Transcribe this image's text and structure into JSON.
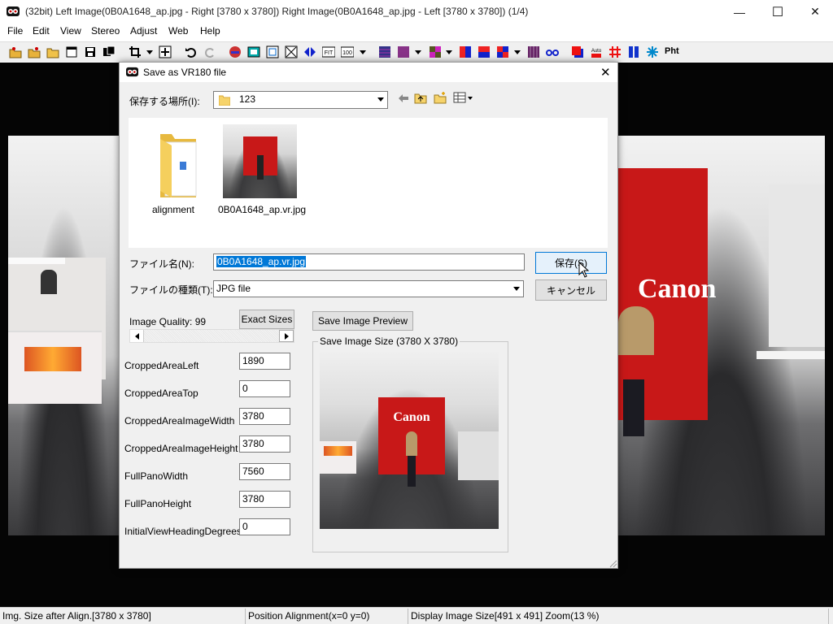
{
  "window": {
    "title": "(32bit) Left Image(0B0A1648_ap.jpg - Right [3780 x 3780]) Right Image(0B0A1648_ap.jpg - Left [3780 x 3780])  (1/4)",
    "minimize": "—",
    "maximize": "☐",
    "close": "✕"
  },
  "menu": {
    "file": "File",
    "edit": "Edit",
    "view": "View",
    "stereo": "Stereo",
    "adjust": "Adjust",
    "web": "Web",
    "help": "Help"
  },
  "toolbar": {
    "auto_label": "Auto",
    "pht_label": "Pht"
  },
  "dialog": {
    "title": "Save as VR180 file",
    "close": "✕",
    "location_label": "保存する場所(I):",
    "location_value": "123",
    "files": [
      {
        "name": "alignment",
        "kind": "folder"
      },
      {
        "name": "0B0A1648_ap.vr.jpg",
        "kind": "image"
      }
    ],
    "filename_label": "ファイル名(N):",
    "filename_value": "0B0A1648_ap.vr.jpg",
    "filetype_label": "ファイルの種類(T):",
    "filetype_value": "JPG file",
    "save_button": "保存(S)",
    "cancel_button": "キャンセル",
    "quality_label": "Image Quality: 99",
    "exact_sizes_button": "Exact Sizes",
    "preview_button": "Save Image Preview",
    "save_size_label": "Save Image Size (3780 X 3780)",
    "params": [
      {
        "label": "CroppedAreaLeft",
        "value": "1890"
      },
      {
        "label": "CroppedAreaTop",
        "value": "0"
      },
      {
        "label": "CroppedAreaImageWidth",
        "value": "3780"
      },
      {
        "label": "CroppedAreaImageHeight",
        "value": "3780"
      },
      {
        "label": "FullPanoWidth",
        "value": "7560"
      },
      {
        "label": "FullPanoHeight",
        "value": "3780"
      },
      {
        "label": "InitialViewHeadingDegrees",
        "value": "0"
      }
    ],
    "preview_sign": "Canon"
  },
  "status": {
    "size_after_align": "Img. Size after Align.[3780 x 3780]",
    "position": "Position Alignment(x=0 y=0)",
    "display_size": "Display Image Size[491 x 491]  Zoom(13 %)"
  }
}
